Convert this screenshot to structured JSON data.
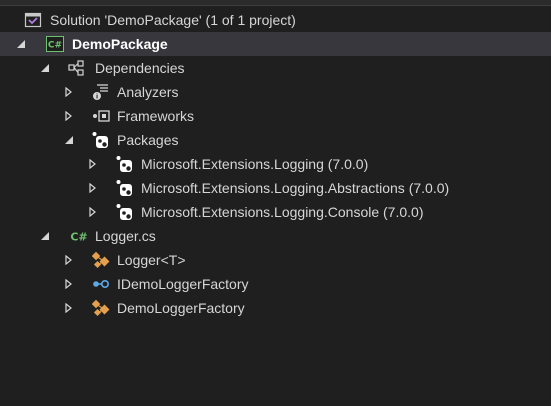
{
  "solution_explorer": {
    "solution": {
      "label": "Solution 'DemoPackage' (1 of 1 project)",
      "icon": "solution-icon"
    },
    "project": {
      "label": "DemoPackage",
      "icon": "csharp-project-icon",
      "expanded": true
    },
    "dependencies": {
      "label": "Dependencies",
      "icon": "dependencies-icon",
      "expanded": true
    },
    "analyzers": {
      "label": "Analyzers",
      "icon": "analyzer-icon"
    },
    "frameworks": {
      "label": "Frameworks",
      "icon": "framework-icon"
    },
    "packages": {
      "label": "Packages",
      "icon": "nuget-package-icon",
      "expanded": true
    },
    "package_items": [
      {
        "label": "Microsoft.Extensions.Logging (7.0.0)",
        "icon": "nuget-package-icon"
      },
      {
        "label": "Microsoft.Extensions.Logging.Abstractions (7.0.0)",
        "icon": "nuget-package-icon"
      },
      {
        "label": "Microsoft.Extensions.Logging.Console (7.0.0)",
        "icon": "nuget-package-icon"
      }
    ],
    "file": {
      "label": "Logger.cs",
      "icon": "csharp-file-icon",
      "expanded": true
    },
    "types": [
      {
        "label": "Logger<T>",
        "icon": "class-icon"
      },
      {
        "label": "IDemoLoggerFactory",
        "icon": "interface-icon"
      },
      {
        "label": "DemoLoggerFactory",
        "icon": "class-icon"
      }
    ],
    "colors": {
      "background": "#1f1f1f",
      "selected_row": "#37373d",
      "csharp_green": "#6fc06f",
      "class_orange": "#e6a04d",
      "interface_blue": "#5fa8e6"
    }
  }
}
